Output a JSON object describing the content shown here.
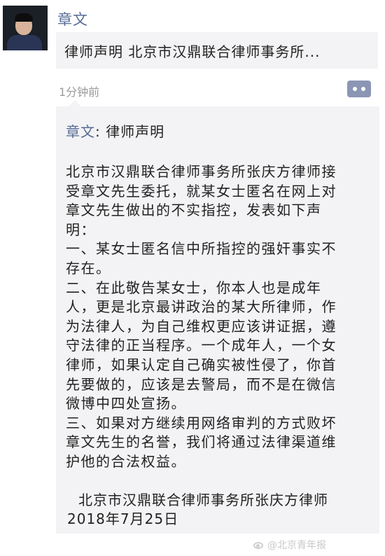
{
  "post": {
    "author": "章文",
    "share_title": "律师声明  北京市汉鼎联合律师事务所...",
    "time": "1分钟前",
    "more_icon": "more-dots-icon"
  },
  "comment": {
    "author": "章文",
    "title_text": ": 律师声明",
    "lines": [
      "北京市汉鼎联合律师事务所张庆方律师接",
      "受章文先生委托，就某女士匿名在网上对",
      "章文先生做出的不实指控，发表如下声",
      "明：",
      "一、某女士匿名信中所指控的强奸事实不",
      "存在。",
      "二、在此敬告某女士，你本人也是成年",
      "人，更是北京最讲政治的某大所律师，作",
      "为法律人，为自己维权更应该讲证据，遵",
      "守法律的正当程序。一个成年人，一个女",
      "律师，如果认定自己确实被性侵了，你首",
      "先要做的，应该是去警局，而不是在微信",
      "微博中四处宣扬。",
      "三、如果对方继续用网络审判的方式败坏",
      "章文先生的名誉，我们将通过法律渠道维",
      "护他的合法权益。"
    ],
    "signature_org": "北京市汉鼎联合律师事务所张庆方律师",
    "signature_date": "2018年7月25日"
  },
  "watermark": {
    "icon": "weibo-icon",
    "text": "@北京青年报"
  },
  "colors": {
    "link_blue": "#576b95",
    "card_bg": "#f3f3f5",
    "more_btn": "#8a96b4"
  }
}
